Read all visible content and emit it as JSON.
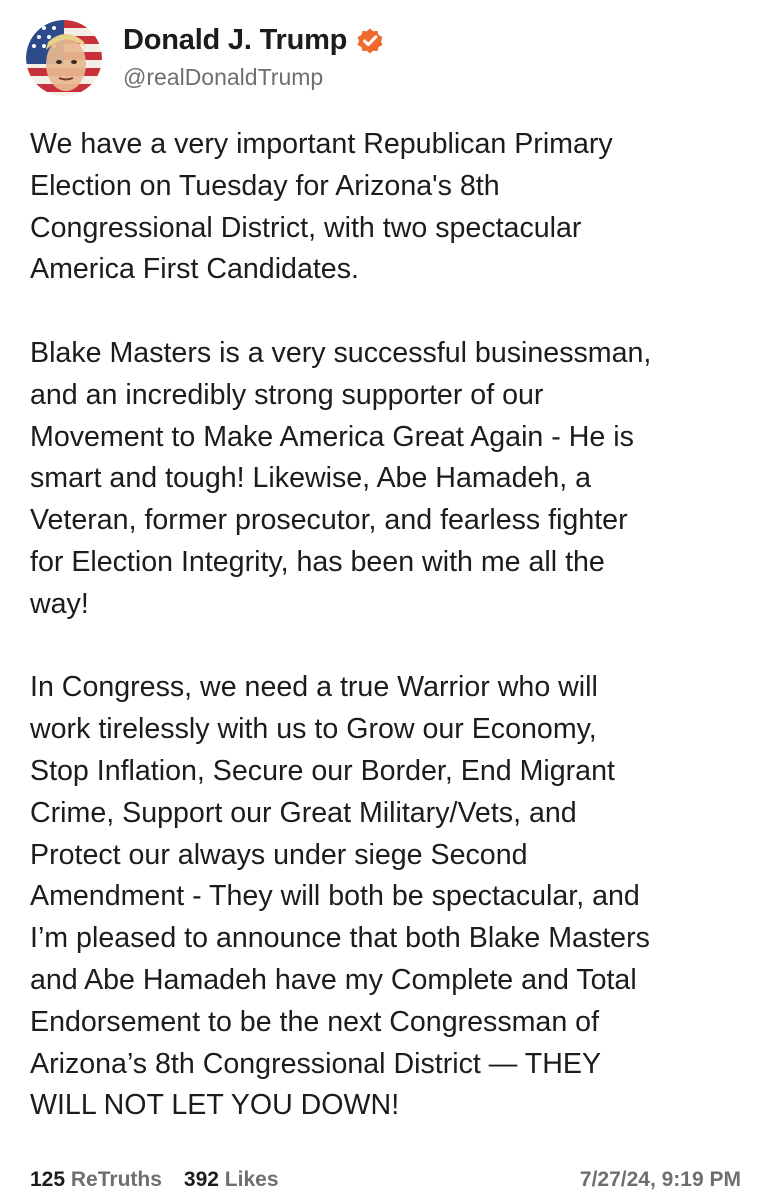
{
  "author": {
    "display_name": "Donald J. Trump",
    "handle": "@realDonaldTrump",
    "verified": true,
    "verified_icon": "verified-badge-icon",
    "verified_color": "#ef6a2c"
  },
  "post": {
    "paragraphs": [
      "We have a very important Republican Primary\nElection on Tuesday for Arizona's 8th\nCongressional District, with two spectacular\nAmerica First Candidates.",
      "Blake Masters is a very successful businessman,\nand an incredibly strong supporter of our\nMovement to Make America Great Again - He is\nsmart and tough! Likewise, Abe Hamadeh, a\nVeteran, former prosecutor, and fearless fighter\nfor Election Integrity, has been with me all the\nway!",
      "In Congress, we need a true Warrior who will\nwork tirelessly with us to Grow our Economy,\nStop Inflation, Secure our Border, End Migrant\nCrime, Support our Great Military/Vets, and\nProtect our always under siege Second\nAmendment - They will both be spectacular, and\nI’m pleased to announce that both Blake Masters\nand Abe Hamadeh have my Complete and Total\nEndorsement to be the next Congressman of\nArizona’s 8th Congressional District — THEY\nWILL NOT LET YOU DOWN!"
    ]
  },
  "stats": {
    "retruths_count": "125",
    "retruths_label": "ReTruths",
    "likes_count": "392",
    "likes_label": "Likes"
  },
  "timestamp": "7/27/24, 9:19 PM"
}
